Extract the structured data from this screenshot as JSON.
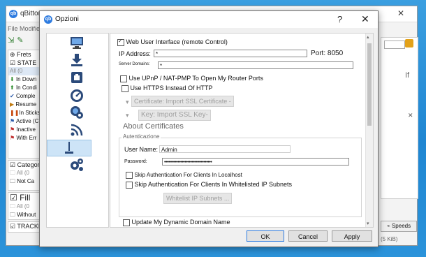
{
  "bg": {
    "title": "qBittorr",
    "menu": "File  Modifie",
    "tab": "Frets",
    "state_header": "STATE",
    "state_items": [
      "All (0",
      "In Down",
      "In Condi",
      "Comple",
      "Resume",
      "In Sticks",
      "Active (C",
      "Inactive",
      "With Err"
    ],
    "category_header": "Category",
    "category_items": [
      "All (0",
      "Not Ca"
    ],
    "fill_header": "Fill",
    "fill_items": [
      "All (0",
      "Without"
    ],
    "tracker_header": "TRACKE",
    "right_partial": "If",
    "speeds": "Speeds",
    "size": "(5 KiB)",
    "close": "✕"
  },
  "dialog": {
    "title": "Opzioni",
    "help": "?",
    "close": "✕",
    "nav_icons": [
      "monitor-icon",
      "download-icon",
      "connection-icon",
      "speedometer-icon",
      "gear-globe-icon",
      "rss-icon",
      "web-ui-icon",
      "advanced-gears-icon"
    ],
    "web_ui_label": "Web User Interface (remote Control)",
    "ip_label": "IP Address:",
    "ip_value": "*",
    "port_label": "Port: 8050",
    "server_domains_label": "Server Domains:",
    "server_domains_value": "*",
    "upnp_label": "Use UPnP / NAT-PMP To Open My Router Ports",
    "https_label": "Use HTTPS Instead Of HTTP",
    "cert_label": "Certificate:",
    "cert_button": "Import SSL Certificate -",
    "key_label": "Key:",
    "key_button": "Import SSL Key-",
    "about_certs": "About Certificates",
    "auth_legend": "Autenticazione",
    "username_label": "User Name:",
    "username_value": "Admin",
    "password_label": "Password:",
    "password_value": "•••••••••••••••••••••••••••••••••••",
    "skip_localhost": "Skip Authentication For Clients In Localhost",
    "skip_whitelist": "Skip Authentication For Clients In Whitelisted IP Subnets",
    "whitelist_button": "Whitelist IP Subnets ...",
    "dyndns_label": "Update My Dynamic Domain Name",
    "ok": "OK",
    "cancel": "Cancel",
    "apply": "Apply"
  },
  "colors": {
    "accent": "#2d7be0",
    "desktop": "#1f86d2"
  }
}
